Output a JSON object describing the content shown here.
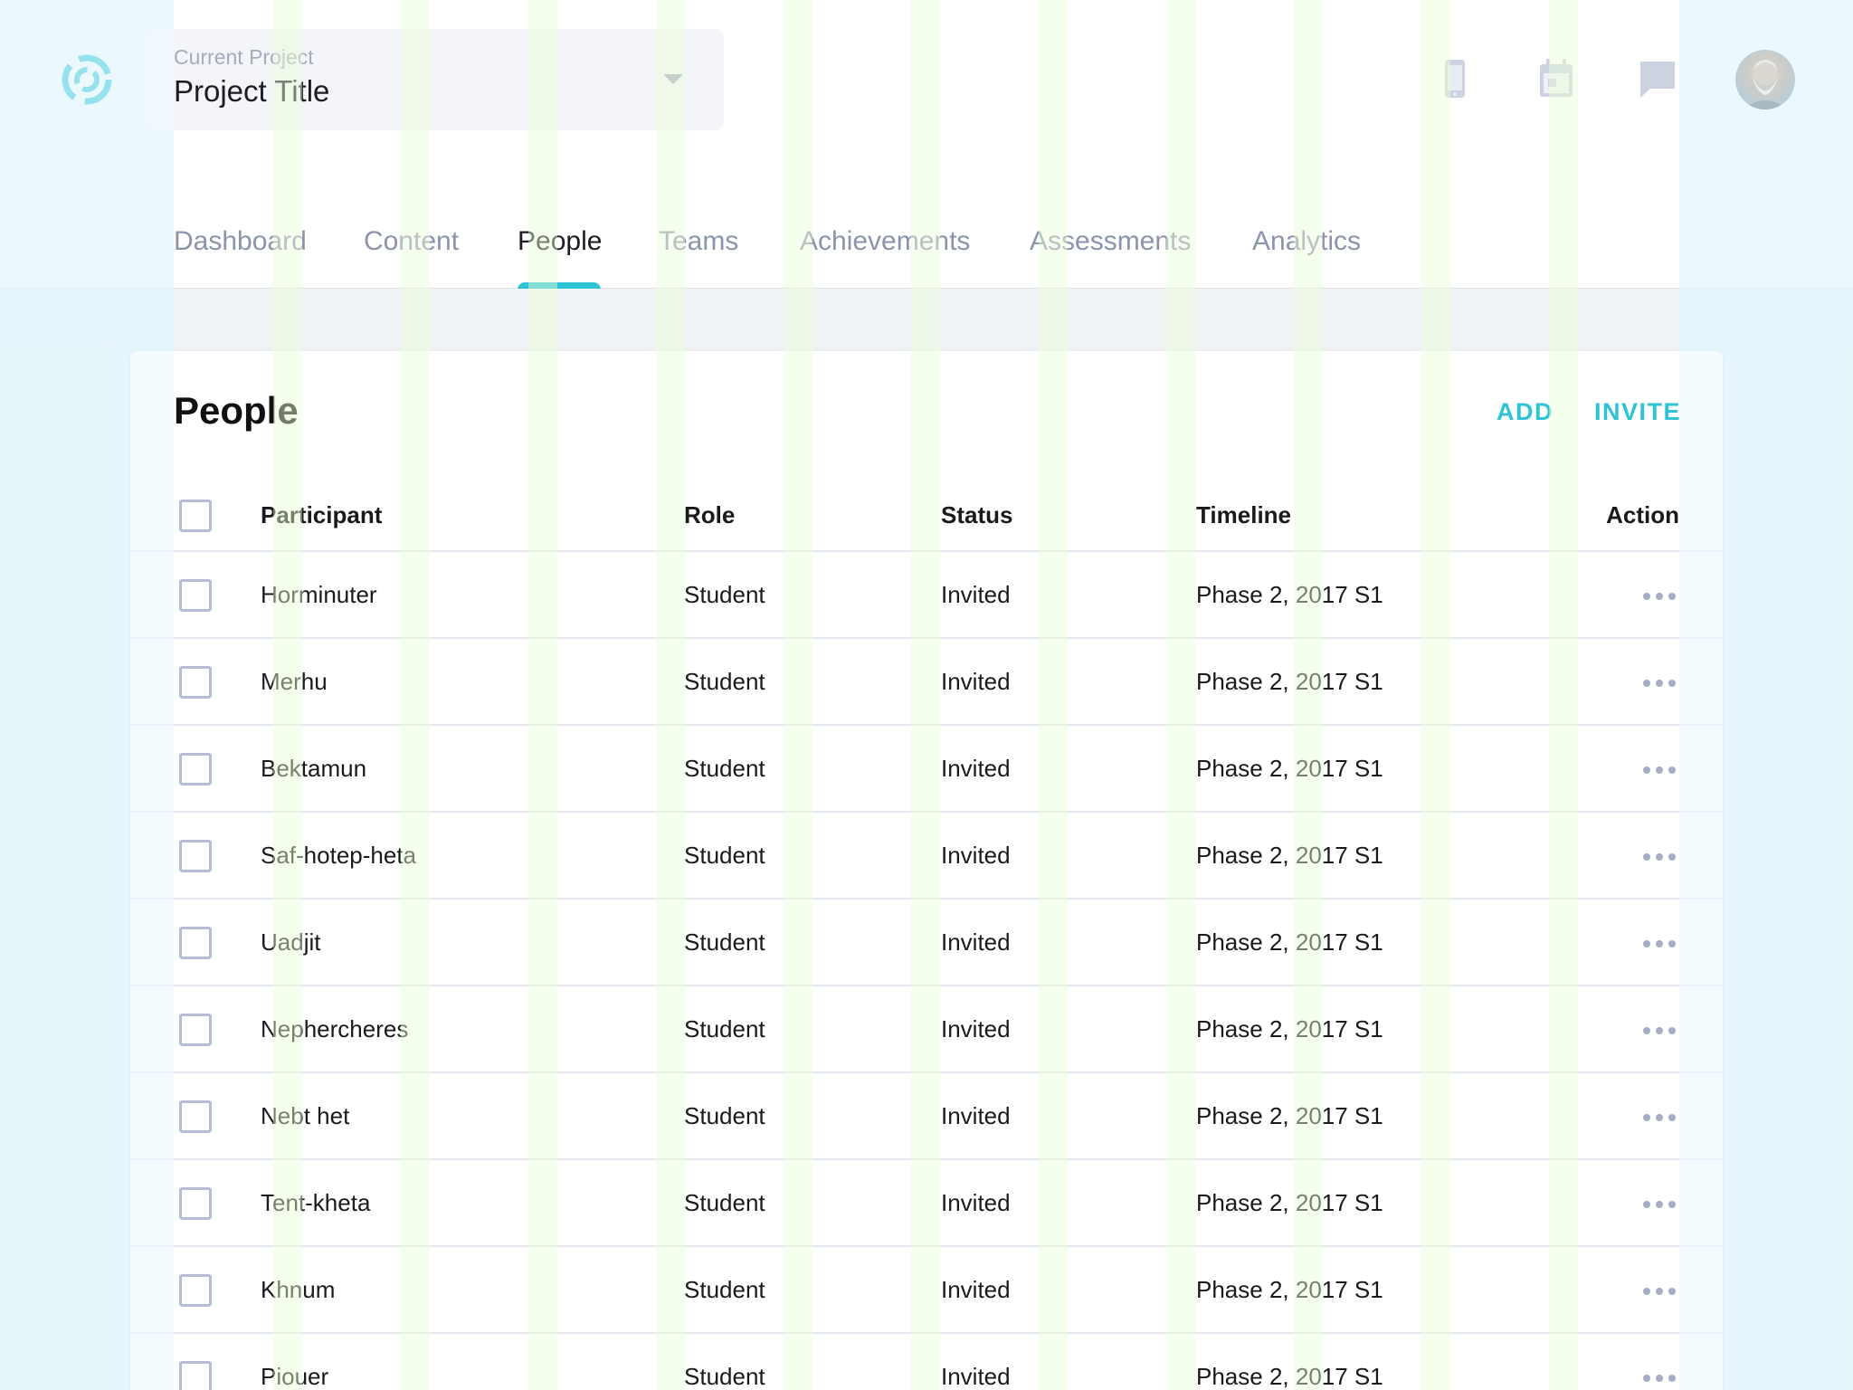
{
  "header": {
    "project_label": "Current Project",
    "project_title": "Project Title",
    "icons": [
      "phone-icon",
      "calendar-icon",
      "chat-icon"
    ]
  },
  "tabs": [
    {
      "label": "Dashboard",
      "active": false
    },
    {
      "label": "Content",
      "active": false
    },
    {
      "label": "People",
      "active": true
    },
    {
      "label": "Teams",
      "active": false
    },
    {
      "label": "Achievements",
      "active": false
    },
    {
      "label": "Assessments",
      "active": false
    },
    {
      "label": "Analytics",
      "active": false
    }
  ],
  "people": {
    "title": "People",
    "add_label": "ADD",
    "invite_label": "INVITE",
    "columns": {
      "participant": "Participant",
      "role": "Role",
      "status": "Status",
      "timeline": "Timeline",
      "action": "Action"
    },
    "rows": [
      {
        "name": "Horminuter",
        "role": "Student",
        "status": "Invited",
        "timeline": "Phase 2, 2017 S1"
      },
      {
        "name": "Merhu",
        "role": "Student",
        "status": "Invited",
        "timeline": "Phase 2, 2017 S1"
      },
      {
        "name": "Bektamun",
        "role": "Student",
        "status": "Invited",
        "timeline": "Phase 2, 2017 S1"
      },
      {
        "name": "Saf-hotep-heta",
        "role": "Student",
        "status": "Invited",
        "timeline": "Phase 2, 2017 S1"
      },
      {
        "name": "Uadjit",
        "role": "Student",
        "status": "Invited",
        "timeline": "Phase 2, 2017 S1"
      },
      {
        "name": "Nephercheres",
        "role": "Student",
        "status": "Invited",
        "timeline": "Phase 2, 2017 S1"
      },
      {
        "name": "Nebt het",
        "role": "Student",
        "status": "Invited",
        "timeline": "Phase 2, 2017 S1"
      },
      {
        "name": "Tent-kheta",
        "role": "Student",
        "status": "Invited",
        "timeline": "Phase 2, 2017 S1"
      },
      {
        "name": "Khnum",
        "role": "Student",
        "status": "Invited",
        "timeline": "Phase 2, 2017 S1"
      },
      {
        "name": "Piouer",
        "role": "Student",
        "status": "Invited",
        "timeline": "Phase 2, 2017 S1"
      }
    ]
  },
  "colors": {
    "accent": "#2ec4d6",
    "muted_text": "#8c93ad",
    "checkbox_border": "#b6bdd6"
  }
}
